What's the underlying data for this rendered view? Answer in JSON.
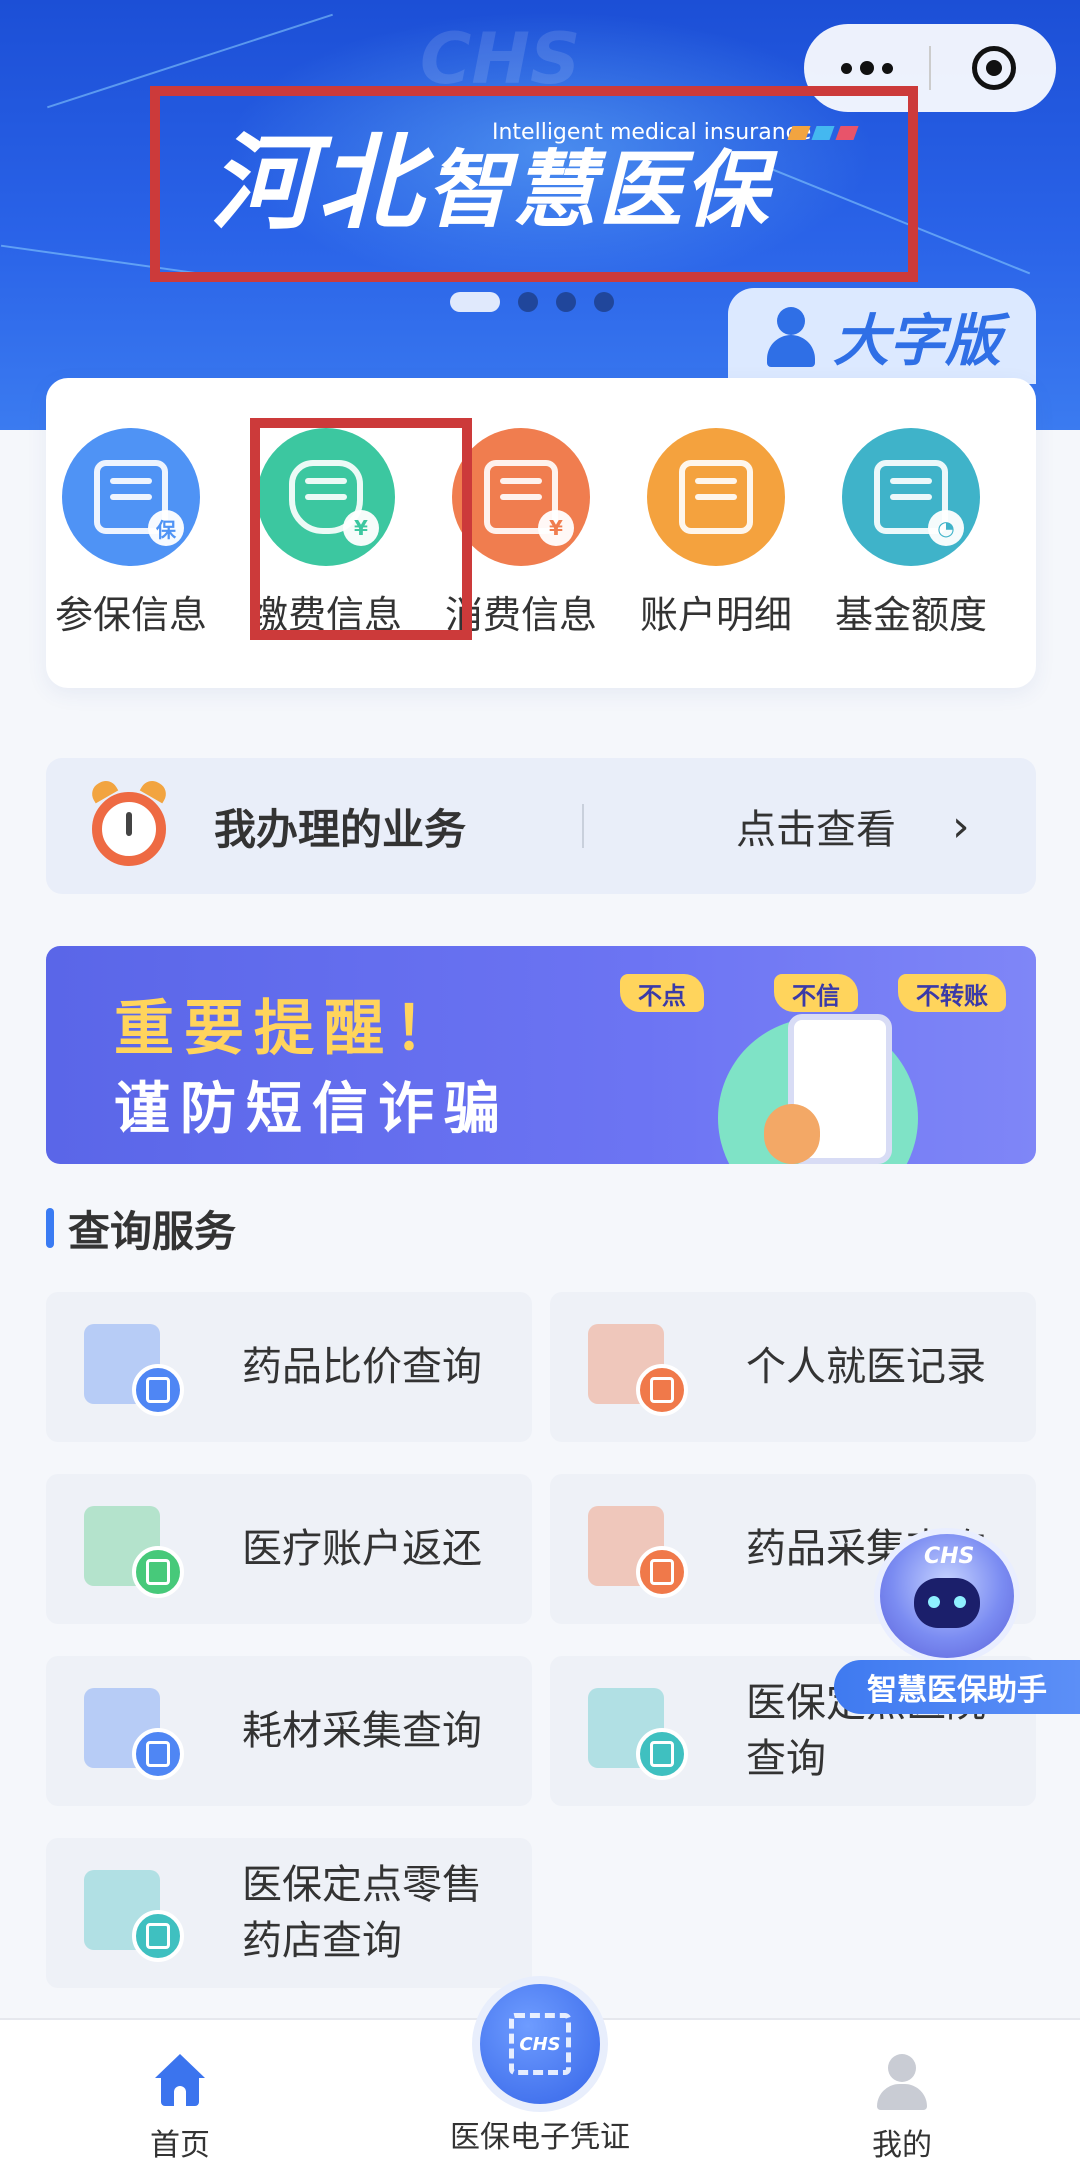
{
  "banner": {
    "watermark": "CHS",
    "title_part1": "河北",
    "title_part2": "智慧医保",
    "subtitle": "Intelligent medical insurance",
    "large_font_label": "大字版",
    "accent_colors": [
      "#f2a440",
      "#44b8f0",
      "#e8546a"
    ]
  },
  "quick_menu": [
    {
      "label": "参保信息",
      "icon": "insurance-doc-icon",
      "color": "#4f93f5"
    },
    {
      "label": "缴费信息",
      "icon": "payment-shield-icon",
      "color": "#3cc7a0"
    },
    {
      "label": "消费信息",
      "icon": "medical-kit-icon",
      "color": "#f07d4f"
    },
    {
      "label": "账户明细",
      "icon": "bill-frame-icon",
      "color": "#f4a23e"
    },
    {
      "label": "基金额度",
      "icon": "fund-chart-icon",
      "color": "#3fb3c9"
    }
  ],
  "my_business": {
    "title": "我办理的业务",
    "action": "点击查看",
    "chevron": "›"
  },
  "warning": {
    "line1": "重要提醒！",
    "line2": "谨防短信诈骗",
    "tags": [
      "不点",
      "不信",
      "不转账"
    ]
  },
  "query_section": {
    "title": "查询服务",
    "items": [
      {
        "label": "药品比价查询",
        "icon": "medicine-compare-icon",
        "color": "#4f86f4"
      },
      {
        "label": "个人就医记录",
        "icon": "medical-record-icon",
        "color": "#f0794a"
      },
      {
        "label": "医疗账户返还",
        "icon": "account-refund-icon",
        "color": "#47c97a"
      },
      {
        "label": "药品采集查询",
        "icon": "pill-icon",
        "color": "#f0794a"
      },
      {
        "label": "耗材采集查询",
        "icon": "stethoscope-icon",
        "color": "#4f86f4"
      },
      {
        "label": "医保定点医院查询",
        "icon": "hospital-icon",
        "color": "#3fc0c0"
      },
      {
        "label": "医保定点零售药店查询",
        "icon": "pharmacy-icon",
        "color": "#3fc0c0"
      }
    ]
  },
  "assistant": {
    "badge": "CHS",
    "label": "智慧医保助手"
  },
  "tabbar": {
    "home": "首页",
    "center": "医保电子凭证",
    "center_badge": "CHS",
    "me": "我的"
  }
}
